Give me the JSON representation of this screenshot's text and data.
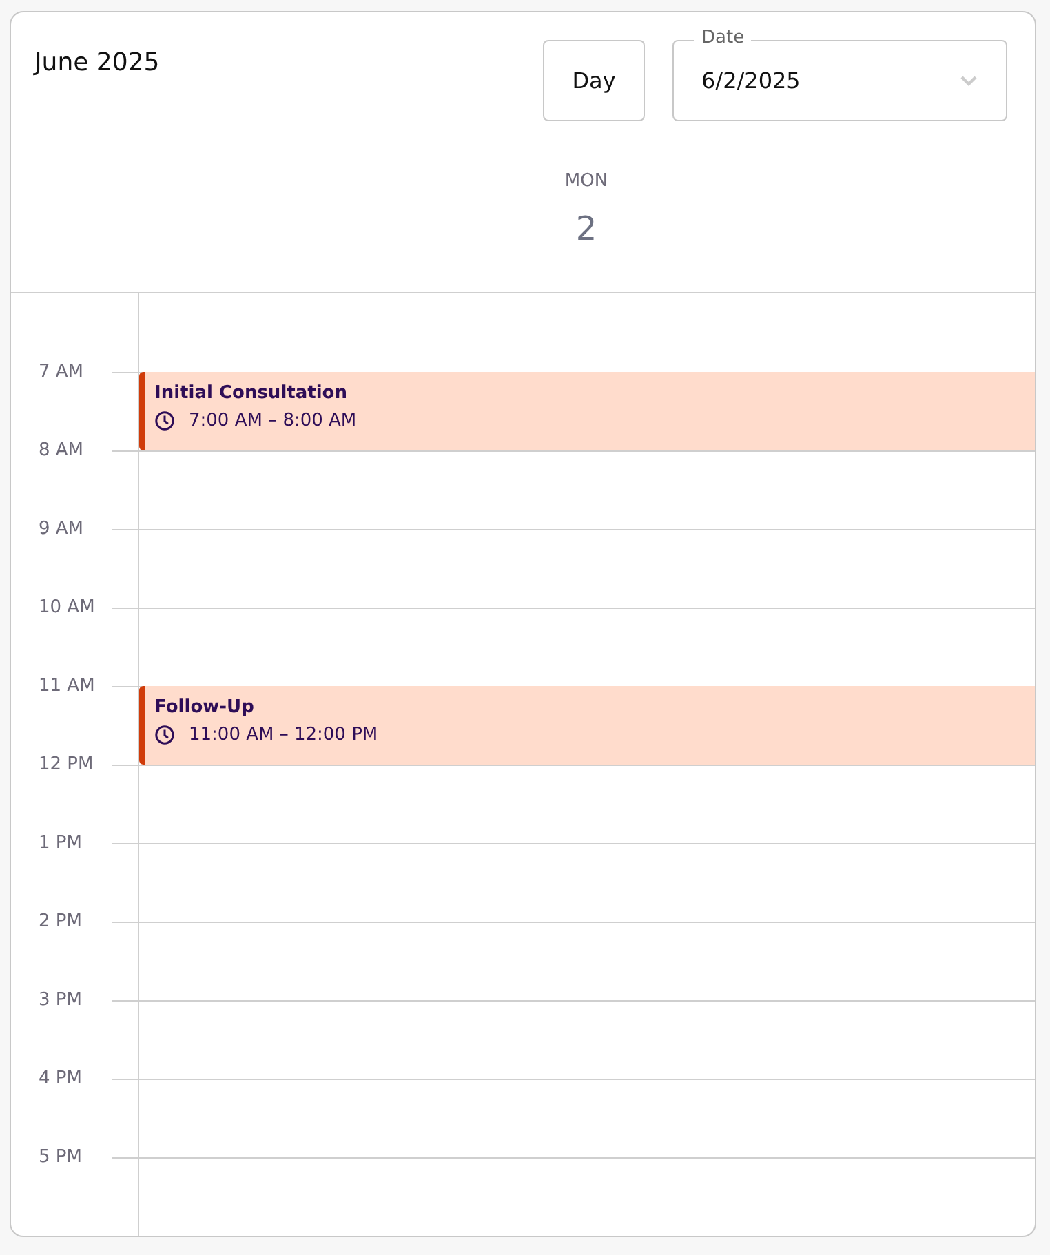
{
  "header": {
    "title": "June 2025",
    "view_button": "Day",
    "date_field": {
      "label": "Date",
      "value": "6/2/2025"
    }
  },
  "day_column": {
    "weekday": "MON",
    "day": "2"
  },
  "hours": [
    {
      "label": "7 AM",
      "events": [
        {
          "title": "Initial Consultation",
          "time": "7:00 AM – 8:00 AM",
          "color": "#d03c0a"
        }
      ]
    },
    {
      "label": "8 AM"
    },
    {
      "label": "9 AM"
    },
    {
      "label": "10 AM"
    },
    {
      "label": "11 AM",
      "events": [
        {
          "title": "Follow-Up",
          "time": "11:00 AM – 12:00 PM",
          "color": "#d03c0a"
        }
      ]
    },
    {
      "label": "12 PM"
    },
    {
      "label": "1 PM"
    },
    {
      "label": "2 PM"
    },
    {
      "label": "3 PM"
    },
    {
      "label": "4 PM"
    },
    {
      "label": "5 PM"
    }
  ]
}
